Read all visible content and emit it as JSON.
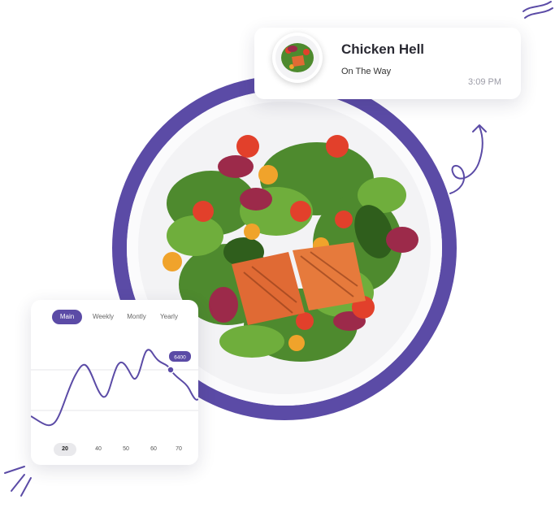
{
  "order": {
    "title": "Chicken Hell",
    "status": "On The Way",
    "time": "3:09 PM"
  },
  "chart_card": {
    "tabs": [
      "Main",
      "Weekly",
      "Montly",
      "Yearly"
    ],
    "active_tab": "Main",
    "marker_label": "6400",
    "x_labels": [
      "20",
      "40",
      "50",
      "60",
      "70"
    ],
    "active_x": "20"
  },
  "colors": {
    "accent": "#5b4ba6",
    "ring": "#5b4ba6"
  },
  "icons": {
    "arrow": "curly-arrow-icon",
    "decor": "scribble-lines-icon"
  }
}
